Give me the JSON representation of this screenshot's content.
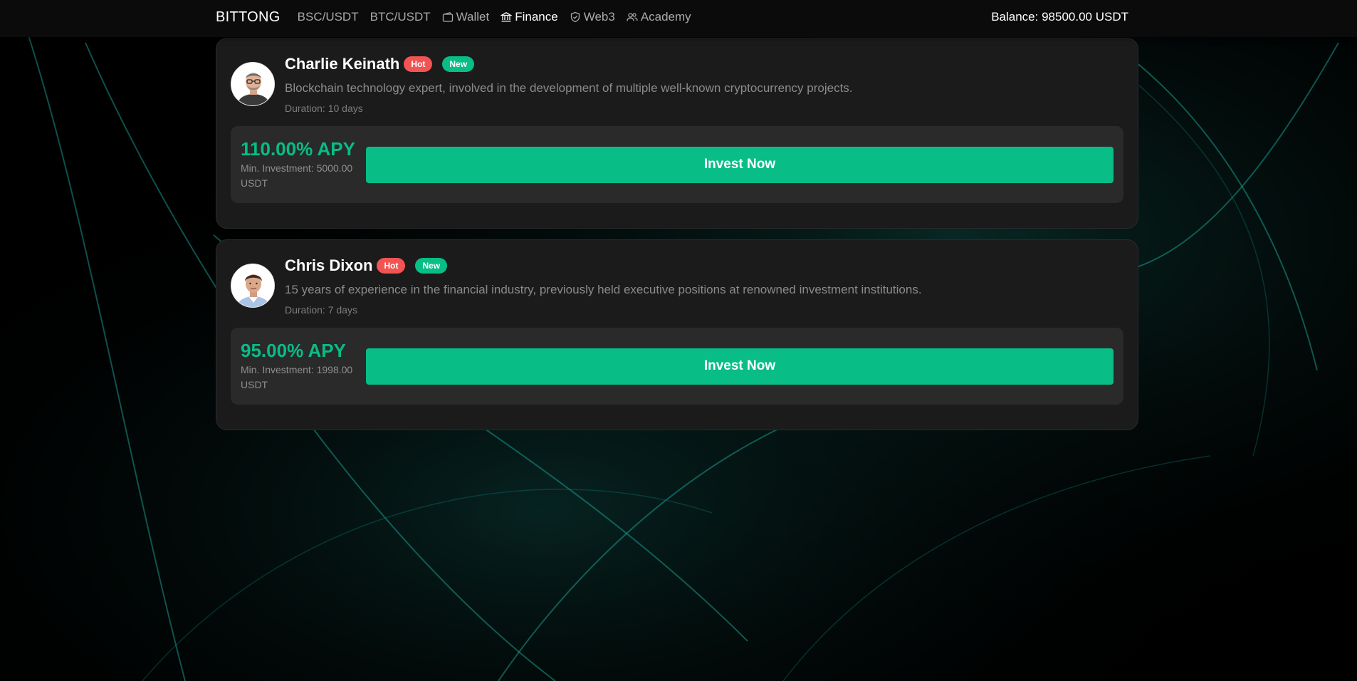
{
  "header": {
    "brand": "BITTONG",
    "nav": [
      {
        "label": "BSC/USDT",
        "icon": ""
      },
      {
        "label": "BTC/USDT",
        "icon": ""
      },
      {
        "label": "Wallet",
        "icon": "wallet-icon"
      },
      {
        "label": "Finance",
        "icon": "bank-icon",
        "active": true
      },
      {
        "label": "Web3",
        "icon": "shield-icon"
      },
      {
        "label": "Academy",
        "icon": "users-icon"
      }
    ],
    "balance": "Balance: 98500.00 USDT"
  },
  "products": [
    {
      "name": "Charlie Keinath",
      "badges": [
        "Hot",
        "New"
      ],
      "description": "Blockchain technology expert, involved in the development of multiple well-known cryptocurrency projects.",
      "duration": "Duration: 10 days",
      "apy": "110.00% APY",
      "min_investment": "Min. Investment: 5000.00 USDT",
      "button_label": "Invest Now"
    },
    {
      "name": "Chris Dixon",
      "badges": [
        "Hot",
        "New"
      ],
      "description": "15 years of experience in the financial industry, previously held executive positions at renowned investment institutions.",
      "duration": "Duration: 7 days",
      "apy": "95.00% APY",
      "min_investment": "Min. Investment: 1998.00 USDT",
      "button_label": "Invest Now"
    }
  ],
  "colors": {
    "accent": "#08bd86",
    "hot": "#f25454",
    "card_bg": "#1b1b1b",
    "panel_bg": "#2a2a2a",
    "page_bg": "#000000"
  }
}
